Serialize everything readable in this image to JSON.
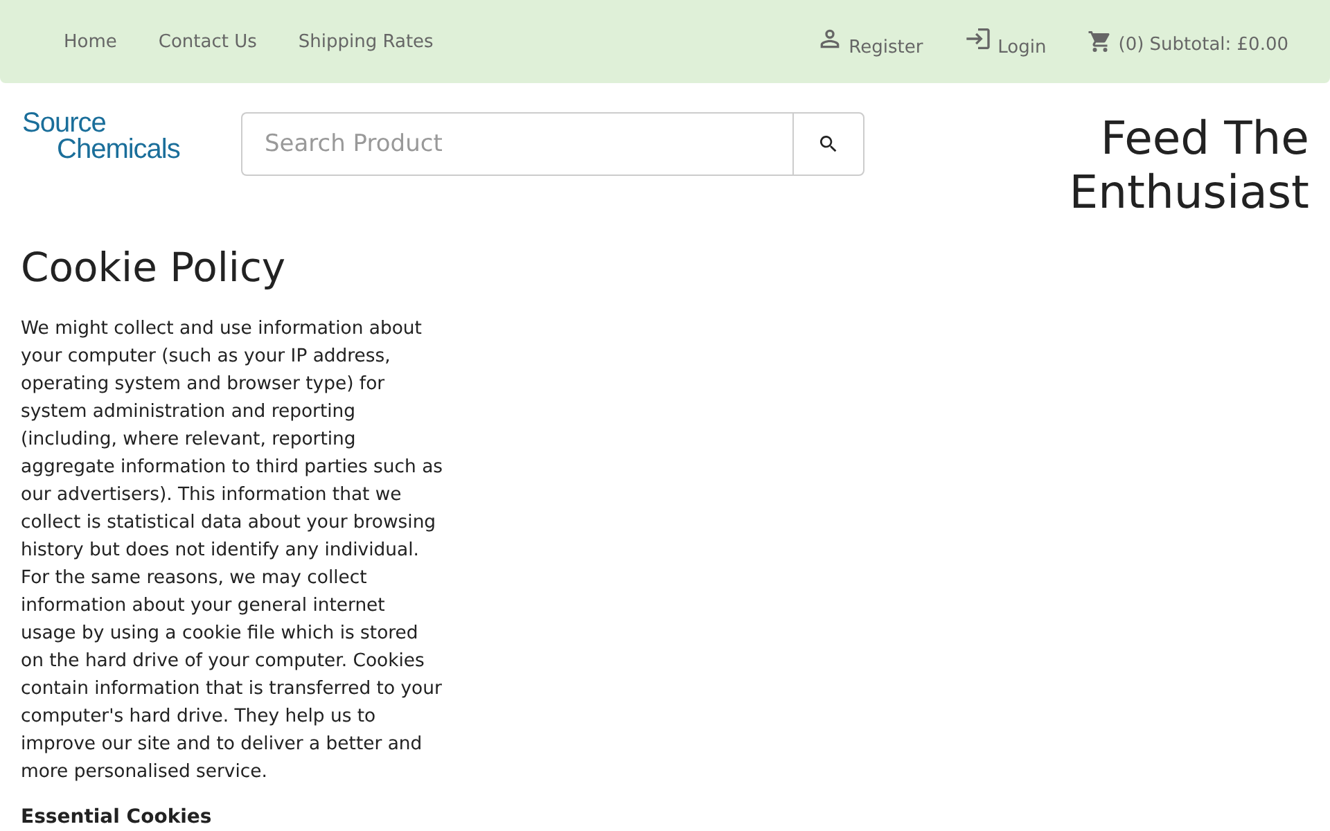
{
  "nav": {
    "links": [
      "Home",
      "Contact Us",
      "Shipping Rates"
    ],
    "register": "Register",
    "login": "Login",
    "cart": "(0) Subtotal: £0.00"
  },
  "logo": {
    "line_1": "Source",
    "line_2": "Chemicals"
  },
  "search": {
    "placeholder": "Search Product"
  },
  "tagline": "Feed The Enthusiast",
  "content": {
    "title": "Cookie Policy",
    "paragraph": "We might collect and use information about your computer (such as your IP address, operating system and browser type) for system administration and reporting (including, where relevant, reporting aggregate information to third parties such as our advertisers). This information that we collect is statistical data about your browsing history but does not identify any individual. For the same reasons, we may collect information about your general internet usage by using a cookie file which is stored on the hard drive of your computer. Cookies contain information that is transferred to your computer's hard drive. They help us to improve our site and to deliver a better and more personalised service.",
    "subheading": "Essential Cookies"
  }
}
